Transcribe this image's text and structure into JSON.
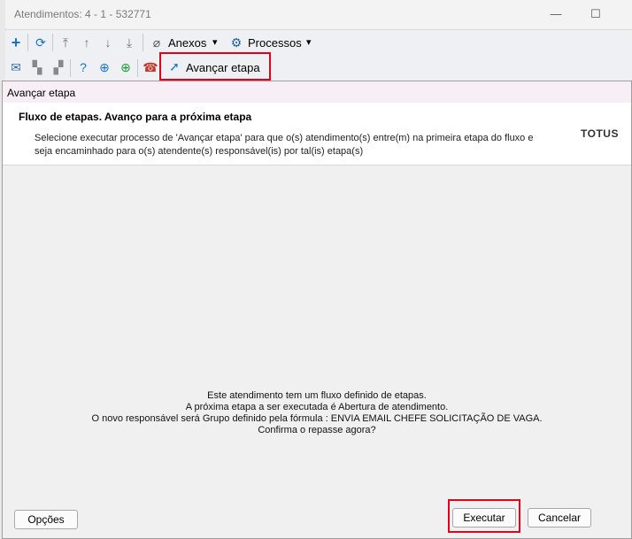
{
  "window": {
    "title": "Atendimentos: 4 - 1 - 532771",
    "minimize_glyph": "—",
    "maximize_glyph": "☐"
  },
  "toolbar": {
    "anexos_label": "Anexos",
    "processos_label": "Processos",
    "dropdown_glyph": "▾",
    "avancar_label": "Avançar etapa"
  },
  "dialog": {
    "caption": "Avançar etapa",
    "header_title": "Fluxo de etapas. Avanço para a próxima etapa",
    "header_description": "Selecione executar processo de 'Avançar etapa' para que o(s) atendimento(s) entre(m) na primeira etapa do fluxo e seja encaminhado para o(s) atendente(s) responsável(is) por tal(is) etapa(s)",
    "logo_text": "TOTUS",
    "message_lines": [
      "Este atendimento tem um fluxo definido de etapas.",
      "A próxima etapa a ser executada é Abertura de atendimento.",
      "O novo responsável será Grupo definido pela fórmula : ENVIA EMAIL CHEFE SOLICITAÇÃO DE VAGA.",
      "Confirma o repasse agora?"
    ],
    "buttons": {
      "options": "Opções",
      "execute": "Executar",
      "cancel": "Cancelar"
    }
  },
  "icons": {
    "add": "plus-icon",
    "refresh": "refresh-icon",
    "move_top": "arrow-top-icon",
    "move_up": "arrow-up-icon",
    "move_down": "arrow-down-icon",
    "move_bottom": "arrow-bottom-icon",
    "attach": "paperclip-icon",
    "process": "gear-icon",
    "mail": "mail-icon",
    "help": "help-icon"
  },
  "colors": {
    "highlight": "#e3001b",
    "accent_blue": "#1a73c8"
  }
}
